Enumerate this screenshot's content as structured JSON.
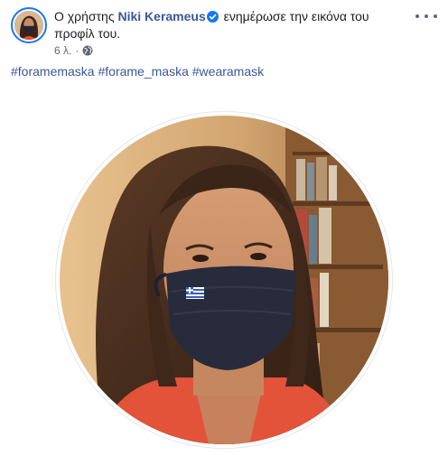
{
  "post": {
    "prefix": "Ο χρήστης",
    "author": "Niki Kerameus",
    "action": "ενημέρωσε την εικόνα του προφίλ του.",
    "time": "6 λ.",
    "separator": "·"
  },
  "hashtags": [
    "#foramemaska",
    "#forame_maska",
    "#wearamask"
  ],
  "icons": {
    "verified": "verified-badge-icon",
    "audience": "globe-icon",
    "more": "more-options-icon"
  },
  "colors": {
    "author_link": "#385898",
    "verified": "#1877f2",
    "meta_text": "#606770"
  }
}
